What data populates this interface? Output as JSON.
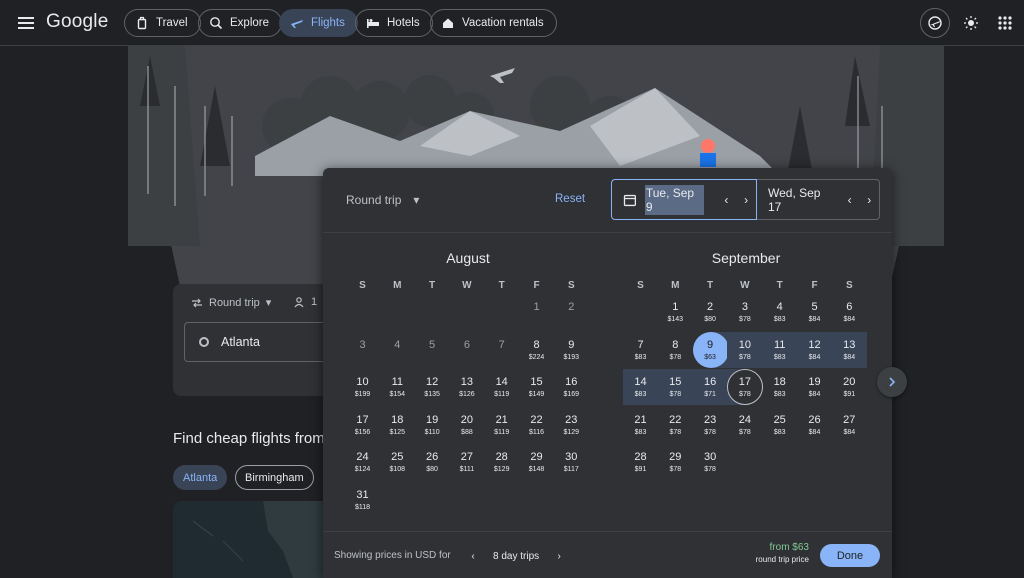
{
  "header": {
    "logo": "Google",
    "nav": [
      {
        "label": "Travel",
        "icon": "travel-bag-icon"
      },
      {
        "label": "Explore",
        "icon": "explore-icon"
      },
      {
        "label": "Flights",
        "icon": "flight-icon",
        "active": true
      },
      {
        "label": "Hotels",
        "icon": "hotel-bed-icon"
      },
      {
        "label": "Vacation rentals",
        "icon": "house-icon"
      }
    ]
  },
  "search": {
    "trip_type": "Round trip",
    "passengers": "1",
    "origin": "Atlanta"
  },
  "cheap": {
    "title": "Find cheap flights from",
    "cities": [
      "Atlanta",
      "Birmingham"
    ]
  },
  "datepicker": {
    "trip_type": "Round trip",
    "reset": "Reset",
    "depart": "Tue, Sep 9",
    "return": "Wed, Sep 17",
    "weekdays": [
      "S",
      "M",
      "T",
      "W",
      "T",
      "F",
      "S"
    ],
    "footer_text": "Showing prices in USD for",
    "trip_length": "8 day trips",
    "from_price": "from $63",
    "price_note": "round trip price",
    "done": "Done",
    "months": [
      {
        "name": "August",
        "days": [
          {
            "n": "1",
            "p": "",
            "dis": true
          },
          {
            "n": "2",
            "p": "",
            "dis": true
          },
          {
            "n": "3",
            "p": "",
            "dis": true
          },
          {
            "n": "4",
            "p": "",
            "dis": true
          },
          {
            "n": "5",
            "p": "",
            "dis": true
          },
          {
            "n": "6",
            "p": "",
            "dis": true
          },
          {
            "n": "7",
            "p": "",
            "dis": true
          },
          {
            "n": "8",
            "p": "$224"
          },
          {
            "n": "9",
            "p": "$193"
          },
          {
            "n": "10",
            "p": "$199"
          },
          {
            "n": "11",
            "p": "$154"
          },
          {
            "n": "12",
            "p": "$135"
          },
          {
            "n": "13",
            "p": "$126"
          },
          {
            "n": "14",
            "p": "$119"
          },
          {
            "n": "15",
            "p": "$149"
          },
          {
            "n": "16",
            "p": "$169"
          },
          {
            "n": "17",
            "p": "$156"
          },
          {
            "n": "18",
            "p": "$125"
          },
          {
            "n": "19",
            "p": "$110"
          },
          {
            "n": "20",
            "p": "$88"
          },
          {
            "n": "21",
            "p": "$119"
          },
          {
            "n": "22",
            "p": "$116"
          },
          {
            "n": "23",
            "p": "$129"
          },
          {
            "n": "24",
            "p": "$124"
          },
          {
            "n": "25",
            "p": "$108"
          },
          {
            "n": "26",
            "p": "$80"
          },
          {
            "n": "27",
            "p": "$111"
          },
          {
            "n": "28",
            "p": "$129"
          },
          {
            "n": "29",
            "p": "$148"
          },
          {
            "n": "30",
            "p": "$117"
          },
          {
            "n": "31",
            "p": "$118"
          }
        ]
      },
      {
        "name": "September",
        "days": [
          {
            "n": "1",
            "p": "$143"
          },
          {
            "n": "2",
            "p": "$80"
          },
          {
            "n": "3",
            "p": "$78"
          },
          {
            "n": "4",
            "p": "$83"
          },
          {
            "n": "5",
            "p": "$84"
          },
          {
            "n": "6",
            "p": "$84"
          },
          {
            "n": "7",
            "p": "$83"
          },
          {
            "n": "8",
            "p": "$78"
          },
          {
            "n": "9",
            "p": "$63"
          },
          {
            "n": "10",
            "p": "$78"
          },
          {
            "n": "11",
            "p": "$83"
          },
          {
            "n": "12",
            "p": "$84"
          },
          {
            "n": "13",
            "p": "$84"
          },
          {
            "n": "14",
            "p": "$83"
          },
          {
            "n": "15",
            "p": "$78"
          },
          {
            "n": "16",
            "p": "$71"
          },
          {
            "n": "17",
            "p": "$78"
          },
          {
            "n": "18",
            "p": "$83"
          },
          {
            "n": "19",
            "p": "$84"
          },
          {
            "n": "20",
            "p": "$91"
          },
          {
            "n": "21",
            "p": "$83"
          },
          {
            "n": "22",
            "p": "$78"
          },
          {
            "n": "23",
            "p": "$78"
          },
          {
            "n": "24",
            "p": "$78"
          },
          {
            "n": "25",
            "p": "$83"
          },
          {
            "n": "26",
            "p": "$84"
          },
          {
            "n": "27",
            "p": "$84"
          },
          {
            "n": "28",
            "p": "$91"
          },
          {
            "n": "29",
            "p": "$78"
          },
          {
            "n": "30",
            "p": "$78"
          }
        ]
      }
    ]
  }
}
